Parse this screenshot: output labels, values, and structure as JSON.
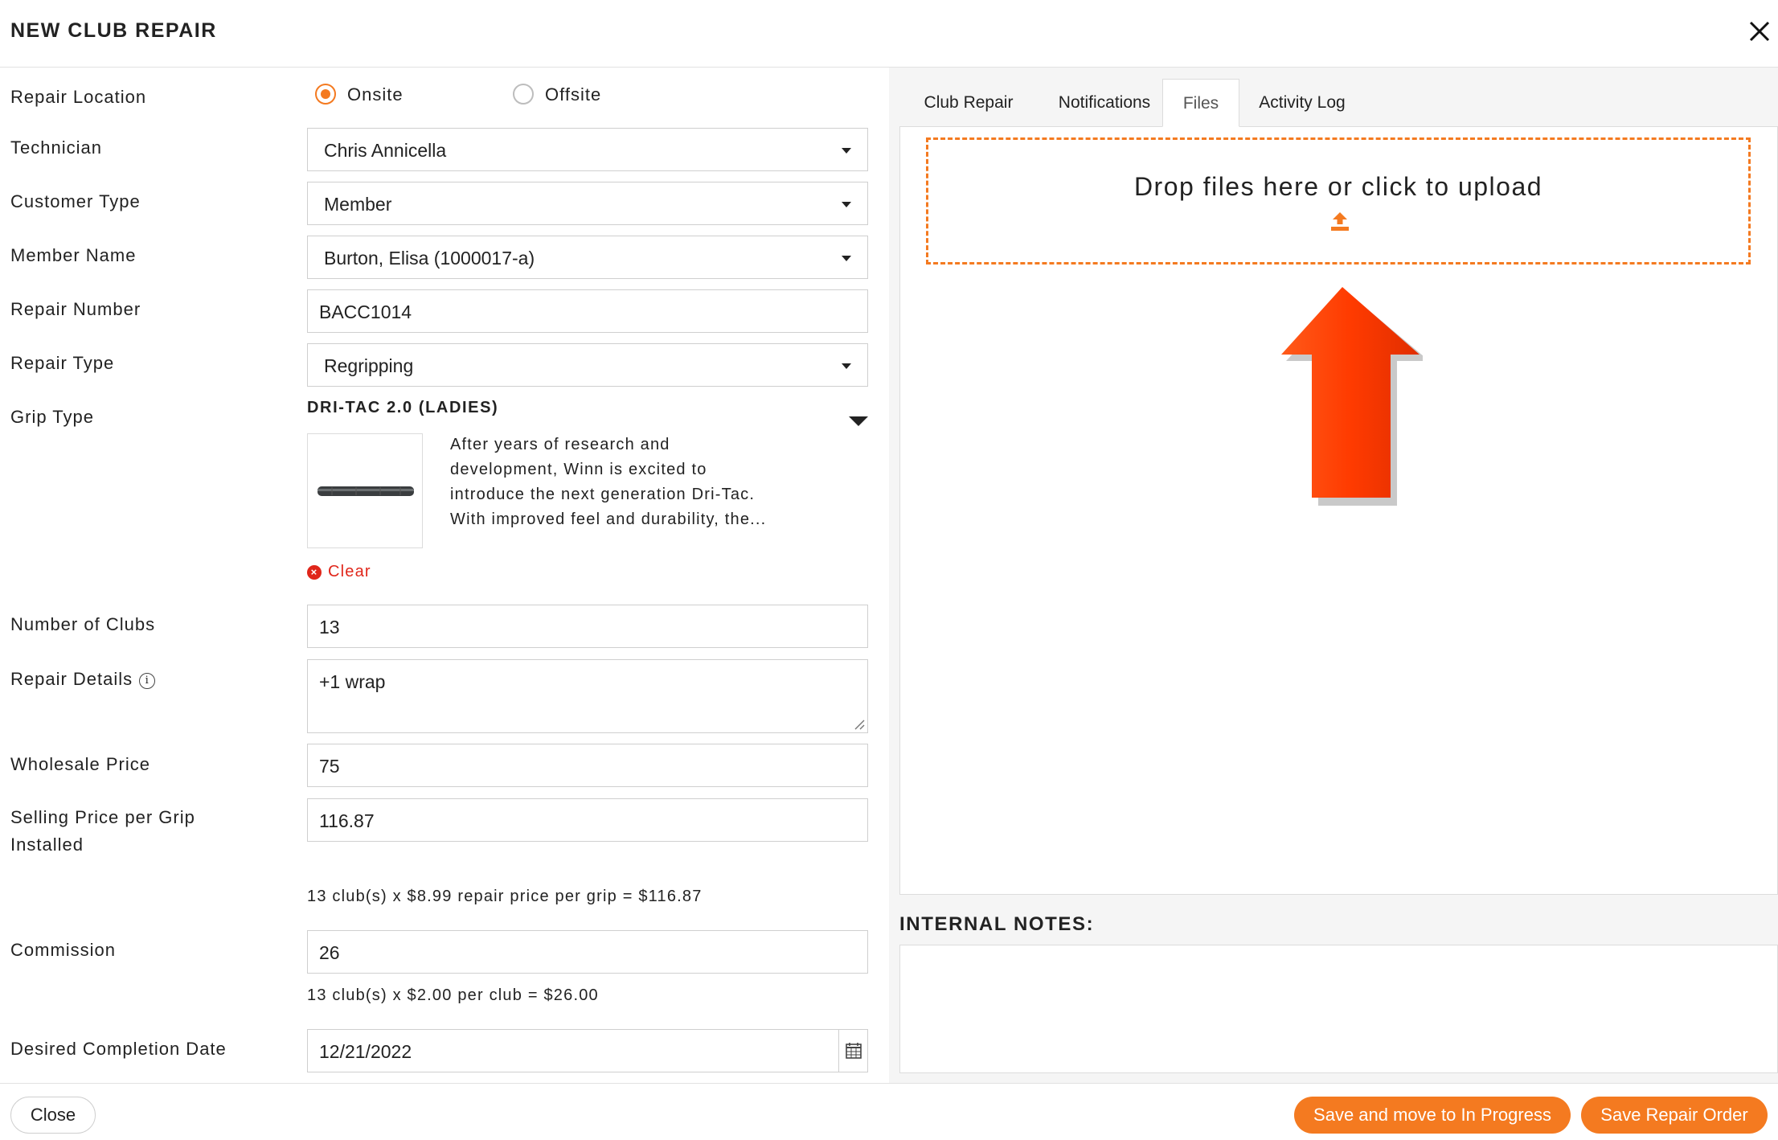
{
  "dialog": {
    "title": "NEW CLUB REPAIR"
  },
  "form": {
    "repair_location": {
      "label": "Repair Location",
      "options": [
        "Onsite",
        "Offsite"
      ],
      "selected": "Onsite"
    },
    "technician": {
      "label": "Technician",
      "value": "Chris Annicella"
    },
    "customer_type": {
      "label": "Customer Type",
      "value": "Member"
    },
    "member_name": {
      "label": "Member Name",
      "value": "Burton, Elisa (1000017-a)"
    },
    "repair_number": {
      "label": "Repair Number",
      "value": "BACC1014"
    },
    "repair_type": {
      "label": "Repair Type",
      "value": "Regripping"
    },
    "grip_type": {
      "label": "Grip Type",
      "name": "DRI-TAC 2.0 (LADIES)",
      "description_lines": [
        "After years of research and",
        "development, Winn is excited to",
        "introduce the next generation Dri-Tac.",
        "With improved feel and durability, the..."
      ],
      "clear_label": "Clear"
    },
    "number_of_clubs": {
      "label": "Number of Clubs",
      "value": "13"
    },
    "repair_details": {
      "label": "Repair Details",
      "value": "+1 wrap"
    },
    "wholesale_price": {
      "label": "Wholesale Price",
      "value": "75"
    },
    "selling_price": {
      "label_line1": "Selling Price per Grip",
      "label_line2": "Installed",
      "value": "116.87",
      "hint": "13 club(s) x $8.99 repair price per grip = $116.87"
    },
    "commission": {
      "label": "Commission",
      "value": "26",
      "hint": "13 club(s) x $2.00 per club = $26.00"
    },
    "desired_completion_date": {
      "label": "Desired Completion Date",
      "value": "12/21/2022"
    }
  },
  "tabs": [
    {
      "label": "Club Repair",
      "active": false
    },
    {
      "label": "Notifications",
      "active": false
    },
    {
      "label": "Files",
      "active": true
    },
    {
      "label": "Activity Log",
      "active": false
    }
  ],
  "files": {
    "dropzone_text": "Drop files here or click to upload"
  },
  "internal_notes": {
    "title": "INTERNAL NOTES:",
    "value": ""
  },
  "footer": {
    "close_label": "Close",
    "save_progress_label": "Save and move to In Progress",
    "save_order_label": "Save Repair Order"
  },
  "colors": {
    "accent": "#f47a20",
    "danger": "#e0261a",
    "arrow": "#ff3b00"
  },
  "icons": [
    "close-icon",
    "caret-down-icon",
    "info-icon",
    "calendar-icon",
    "upload-icon",
    "clear-icon",
    "arrow-up-annotation"
  ]
}
